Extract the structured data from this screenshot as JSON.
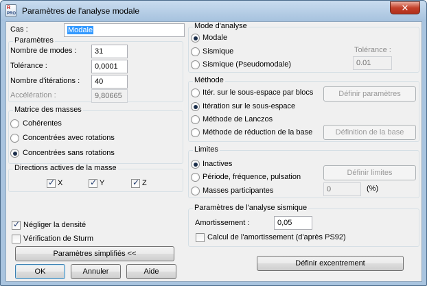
{
  "window": {
    "title": "Paramètres de l'analyse modale",
    "icon_text_top": "R",
    "icon_text_bottom": "PRO",
    "close_glyph": "✕"
  },
  "left": {
    "case_label": "Cas :",
    "case_value": "Modale",
    "params_title": "Paramètres",
    "modes_label": "Nombre de modes :",
    "modes_value": "31",
    "tolerance_label": "Tolérance :",
    "tolerance_value": "0,0001",
    "iterations_label": "Nombre d'itérations :",
    "iterations_value": "40",
    "acceleration_label": "Accélération :",
    "acceleration_value": "9,80665",
    "mass_title": "Matrice des masses",
    "mass_options": [
      "Cohérentes",
      "Concentrées avec rotations",
      "Concentrées sans rotations"
    ],
    "dir_title": "Directions actives de la masse",
    "dir_x": "X",
    "dir_y": "Y",
    "dir_z": "Z",
    "neglect_density": "Négliger la densité",
    "sturm": "Vérification de Sturm"
  },
  "right": {
    "mode_title": "Mode d'analyse",
    "mode_options": [
      "Modale",
      "Sismique",
      "Sismique (Pseudomodale)"
    ],
    "mode_tolerance_label": "Tolérance :",
    "mode_tolerance_value": "0.01",
    "method_title": "Méthode",
    "method_options": [
      "Itér. sur le sous-espace par blocs",
      "Itération sur le sous-espace",
      "Méthode de Lanczos",
      "Méthode de réduction de la base"
    ],
    "define_params_btn": "Définir paramètres",
    "define_base_btn": "Définition de la base",
    "limits_title": "Limites",
    "limit_options": [
      "Inactives",
      "Période, fréquence, pulsation",
      "Masses participantes"
    ],
    "define_limits_btn": "Définir limites",
    "limit_value": "0",
    "limit_unit": "(%)",
    "seismic_title": "Paramètres de l'analyse sismique",
    "damping_label": "Amortissement :",
    "damping_value": "0,05",
    "damping_calc": "Calcul de l'amortissement (d'après PS92)",
    "eccentricity_btn": "Définir excentrement"
  },
  "footer": {
    "simplified_btn": "Paramètres simplifiés <<",
    "ok_btn": "OK",
    "cancel_btn": "Annuler",
    "help_btn": "Aide"
  }
}
